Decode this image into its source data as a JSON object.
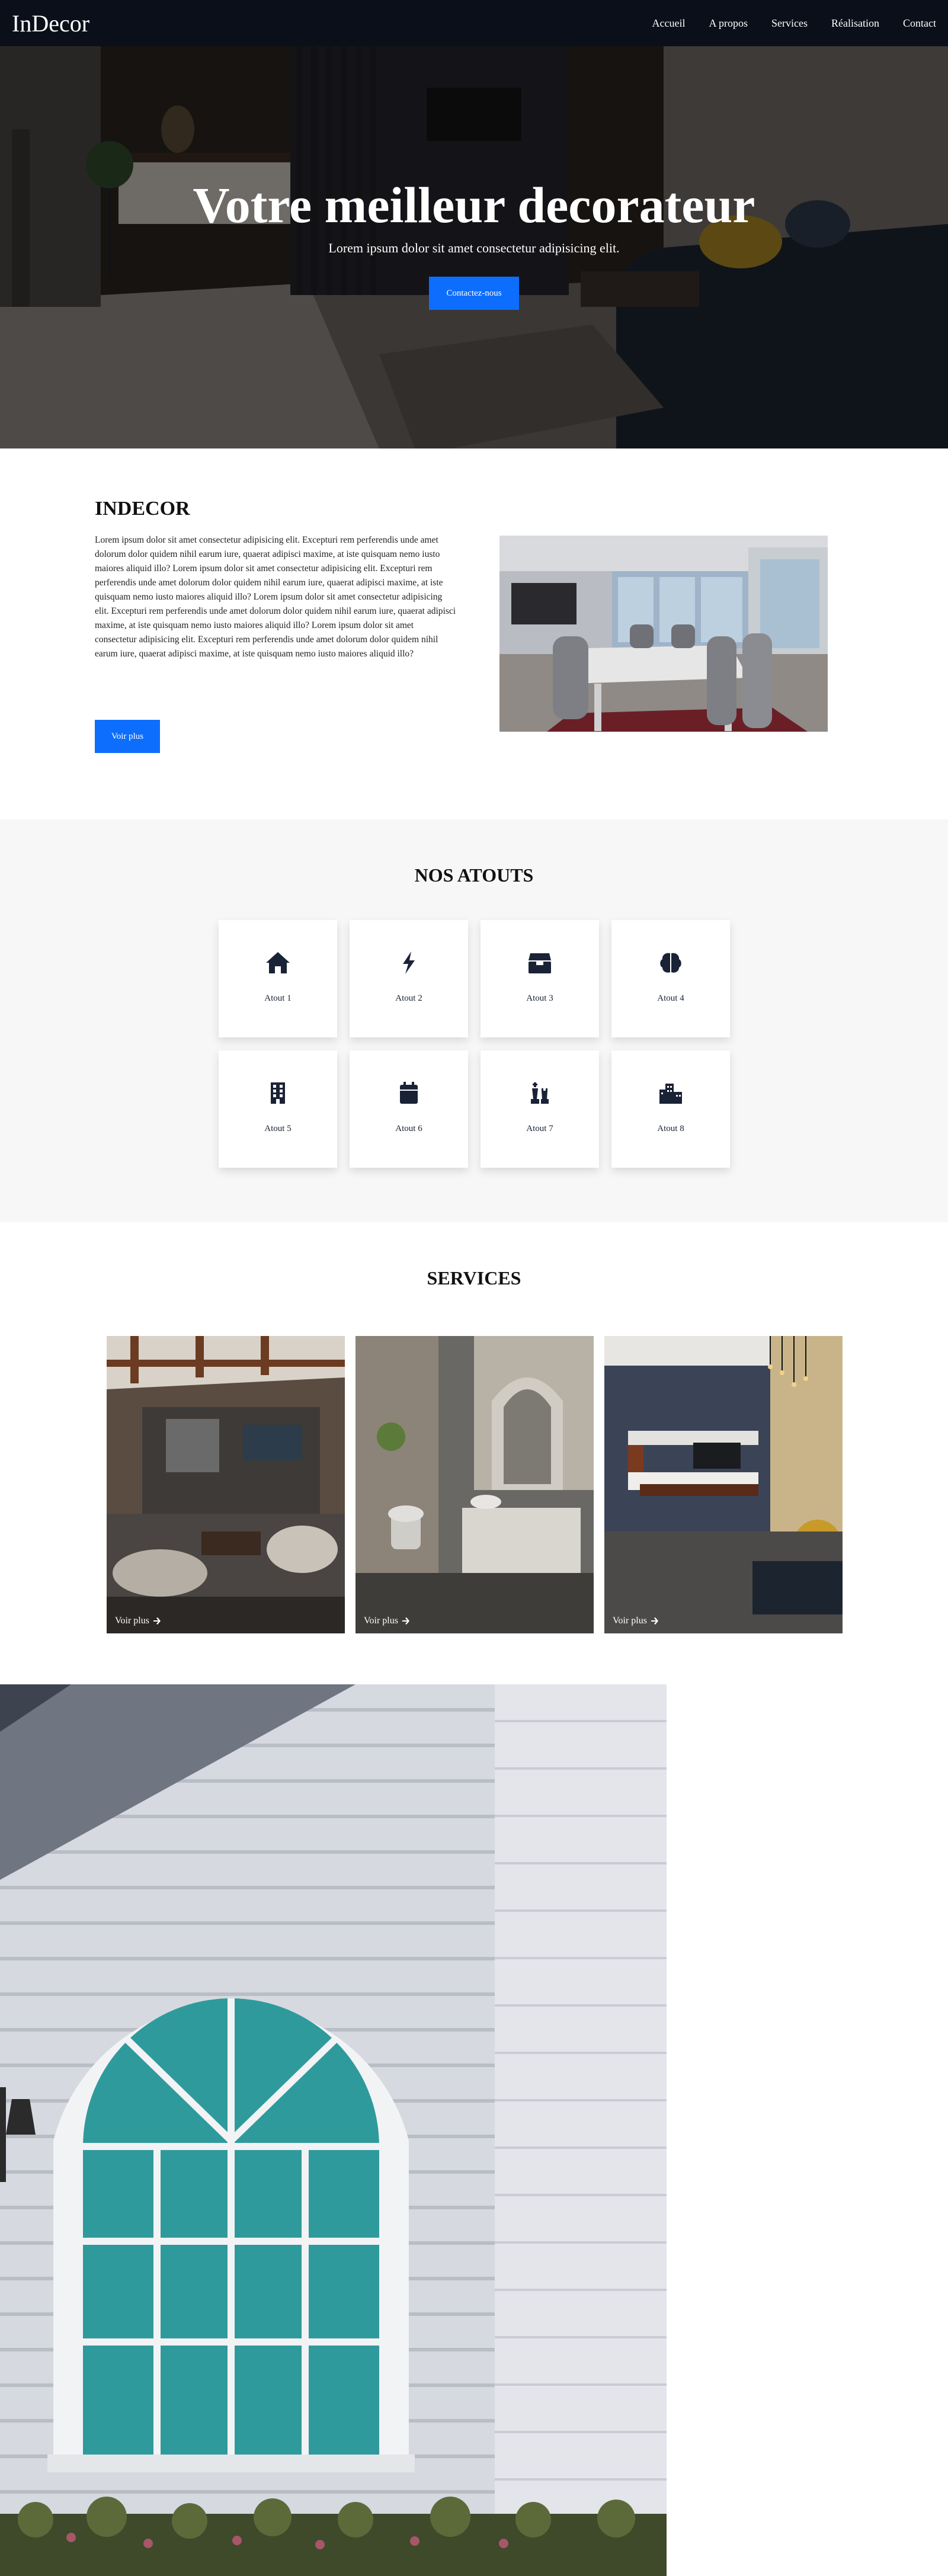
{
  "navbar": {
    "brand": "InDecor",
    "links": [
      "Accueil",
      "A propos",
      "Services",
      "Réalisation",
      "Contact"
    ]
  },
  "hero": {
    "title": "Votre meilleur decorateur",
    "subtitle": "Lorem ipsum dolor sit amet consectetur adipisicing elit.",
    "button": "Contactez-nous"
  },
  "about": {
    "title": "INDECOR",
    "paragraph": "Lorem ipsum dolor sit amet consectetur adipisicing elit. Excepturi rem perferendis unde amet dolorum dolor quidem nihil earum iure, quaerat adipisci maxime, at iste quisquam nemo iusto maiores aliquid illo? Lorem ipsum dolor sit amet consectetur adipisicing elit. Excepturi rem perferendis unde amet dolorum dolor quidem nihil earum iure, quaerat adipisci maxime, at iste quisquam nemo iusto maiores aliquid illo? Lorem ipsum dolor sit amet consectetur adipisicing elit. Excepturi rem perferendis unde amet dolorum dolor quidem nihil earum iure, quaerat adipisci maxime, at iste quisquam nemo iusto maiores aliquid illo? Lorem ipsum dolor sit amet consectetur adipisicing elit. Excepturi rem perferendis unde amet dolorum dolor quidem nihil earum iure, quaerat adipisci maxime, at iste quisquam nemo iusto maiores aliquid illo?",
    "button": "Voir plus"
  },
  "atouts": {
    "title": "NOS ATOUTS",
    "items": [
      {
        "label": "Atout 1",
        "icon": "home-icon"
      },
      {
        "label": "Atout 2",
        "icon": "bolt-icon"
      },
      {
        "label": "Atout 3",
        "icon": "box-icon"
      },
      {
        "label": "Atout 4",
        "icon": "brain-icon"
      },
      {
        "label": "Atout 5",
        "icon": "building-icon"
      },
      {
        "label": "Atout 6",
        "icon": "calendar-icon"
      },
      {
        "label": "Atout 7",
        "icon": "chess-icon"
      },
      {
        "label": "Atout 8",
        "icon": "city-icon"
      }
    ],
    "icon_color": "#1a2236"
  },
  "services": {
    "title": "SERVICES",
    "cards": [
      {
        "link": "Voir plus",
        "icon": "arrow-right-icon"
      },
      {
        "link": "Voir plus",
        "icon": "arrow-right-icon"
      },
      {
        "link": "Voir plus",
        "icon": "arrow-right-icon"
      }
    ]
  },
  "colors": {
    "navbar": "#0b0f19",
    "primary_button": "#0d6efd",
    "atouts_bg": "#f7f7f7"
  }
}
